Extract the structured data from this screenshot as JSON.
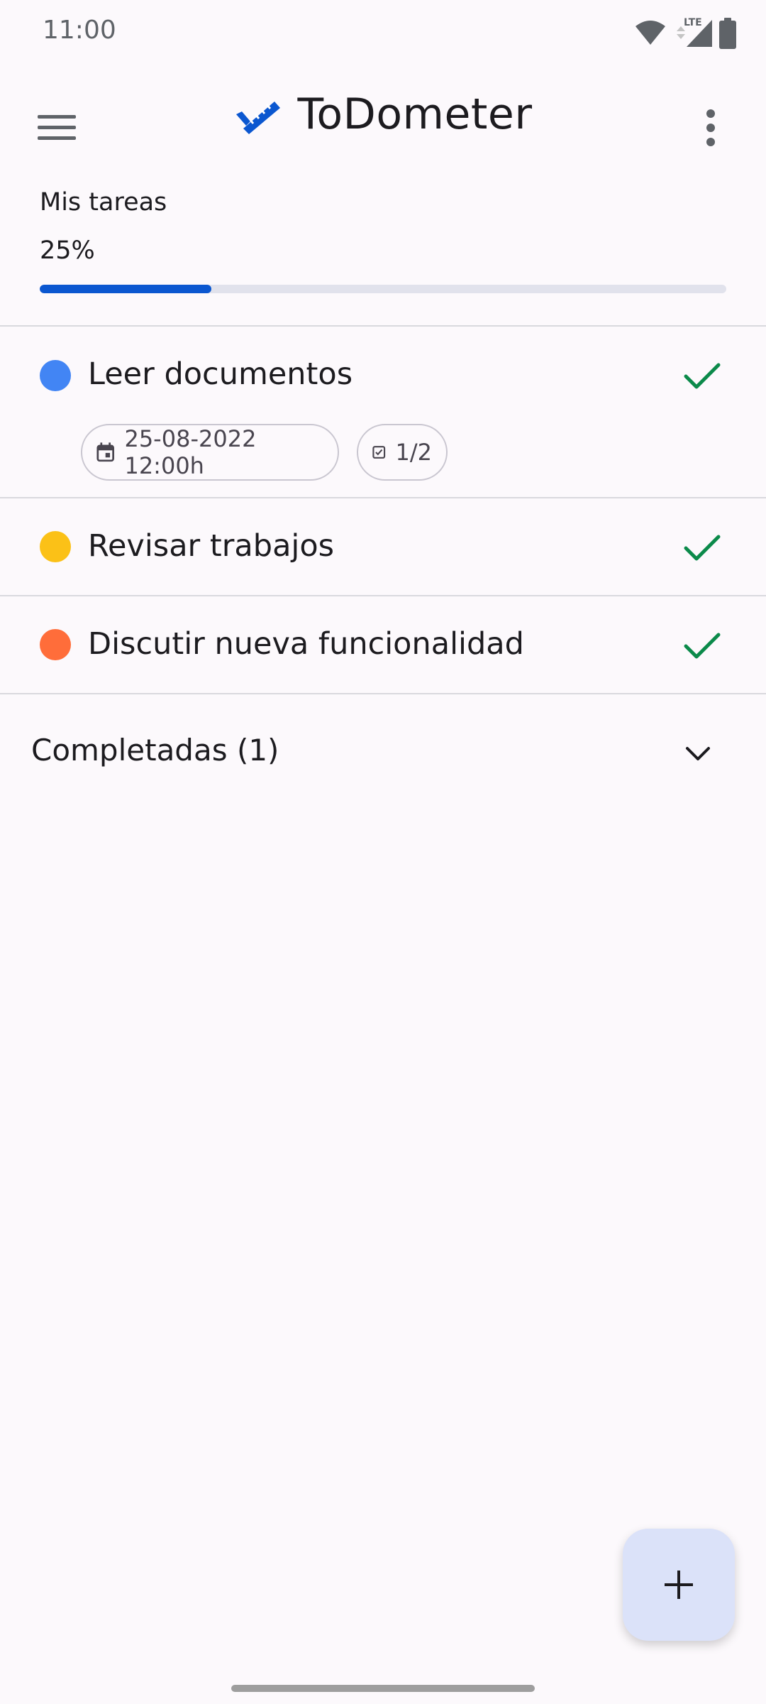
{
  "status_bar": {
    "time": "11:00",
    "network_label": "LTE"
  },
  "app_bar": {
    "title": "ToDometer",
    "menu_icon": "hamburger-menu-icon",
    "more_icon": "more-vert-icon",
    "brand_color": "#0b57d0"
  },
  "progress": {
    "list_name": "Mis tareas",
    "percent_label": "25%",
    "value": 0.25,
    "color": "#0b57d0"
  },
  "tasks": [
    {
      "title": "Leer documentos",
      "dot_color": "#4285f4",
      "chips": {
        "date": "25-08-2022 12:00h",
        "subtasks": "1/2"
      }
    },
    {
      "title": "Revisar trabajos",
      "dot_color": "#fbc117"
    },
    {
      "title": "Discutir nueva funcionalidad",
      "dot_color": "#ff6d3a"
    }
  ],
  "check_color": "#0b8a4a",
  "completed_section": {
    "label": "Completadas (1)"
  },
  "fab": {
    "icon": "add-icon"
  }
}
